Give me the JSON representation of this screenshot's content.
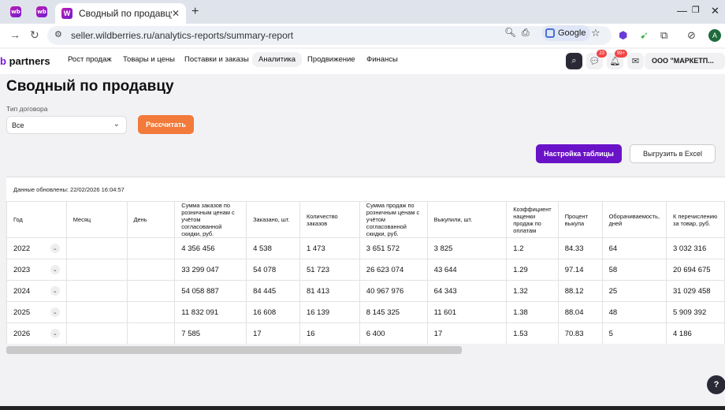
{
  "browser": {
    "pinned_tab_1": "wb",
    "pinned_tab_2": "wb",
    "active_tab_title": "Сводный по продавцу",
    "tab_favicon": "W",
    "url": "seller.wildberries.ru/analytics-reports/summary-report",
    "search_engine": "Google",
    "profile_initial": "A"
  },
  "app": {
    "logo_prefix": "b",
    "logo_text": " partners",
    "nav": [
      "Рост продаж",
      "Товары и цены",
      "Поставки и заказы",
      "Аналитика",
      "Продвижение",
      "Финансы"
    ],
    "active_nav": "Аналитика",
    "chat_badge": "23",
    "notif_badge": "99+",
    "org": "ООО \"МАРКЕТП..."
  },
  "page": {
    "title": "Сводный по продавцу",
    "filter_label": "Тип договора",
    "filter_value": "Все",
    "calculate_label": "Рассчитать",
    "table_settings_label": "Настройка таблицы",
    "export_label": "Выгрузить в Excel",
    "updated_text": "Данные обновлены: 22/02/2026 16:04:57"
  },
  "table": {
    "headers": [
      "Год",
      "Месяц",
      "День",
      "Сумма заказов по розничным ценам с учётом согласованной скидки, руб.",
      "Заказано, шт.",
      "Количество заказов",
      "Сумма продаж по розничным ценам с учётом согласованной скидки, руб.",
      "Выкупили, шт.",
      "Коэффициент наценки продаж по оплатам",
      "Процент выкупа",
      "Оборачиваемость, дней",
      "К перечислению за товар, руб."
    ],
    "rows": [
      [
        "2022",
        "",
        "",
        "4 356 456",
        "4 538",
        "1 473",
        "3 651 572",
        "3 825",
        "1.2",
        "84.33",
        "64",
        "3 032 316"
      ],
      [
        "2023",
        "",
        "",
        "33 299 047",
        "54 078",
        "51 723",
        "26 623 074",
        "43 644",
        "1.29",
        "97.14",
        "58",
        "20 694 675"
      ],
      [
        "2024",
        "",
        "",
        "54 058 887",
        "84 445",
        "81 413",
        "40 967 976",
        "64 343",
        "1.32",
        "88.12",
        "25",
        "31 029 458"
      ],
      [
        "2025",
        "",
        "",
        "11 832 091",
        "16 608",
        "16 139",
        "8 145 325",
        "11 601",
        "1.38",
        "88.04",
        "48",
        "5 909 392"
      ],
      [
        "2026",
        "",
        "",
        "7 585",
        "17",
        "16",
        "6 400",
        "17",
        "1.53",
        "70.83",
        "5",
        "4 186"
      ]
    ]
  },
  "help_label": "?"
}
